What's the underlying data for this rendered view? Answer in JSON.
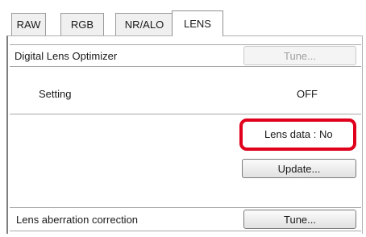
{
  "tabs": [
    {
      "label": "RAW"
    },
    {
      "label": "RGB"
    },
    {
      "label": "NR/ALO"
    },
    {
      "label": "LENS"
    }
  ],
  "active_tab": "LENS",
  "dlo": {
    "title": "Digital Lens Optimizer",
    "tune_label": "Tune...",
    "setting_label": "Setting",
    "setting_value": "OFF",
    "lens_data_label": "Lens data : No",
    "update_label": "Update..."
  },
  "aberration": {
    "title": "Lens aberration correction",
    "tune_label": "Tune..."
  },
  "colors": {
    "highlight": "#e0001b"
  }
}
